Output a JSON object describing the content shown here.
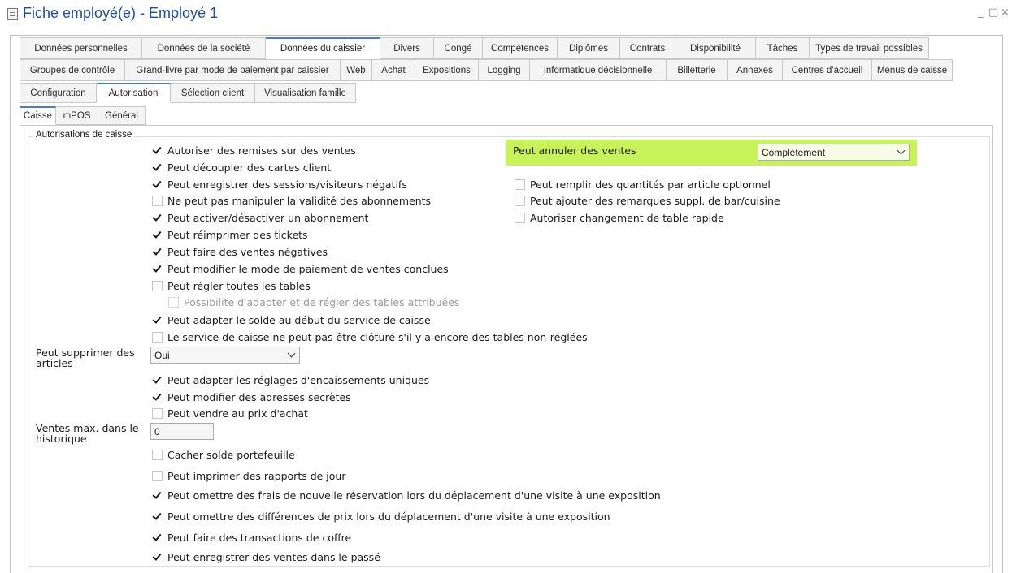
{
  "window": {
    "title": "Fiche employé(e) - Employé 1",
    "controls": [
      "_",
      "□",
      "×"
    ]
  },
  "tabs_row1": [
    {
      "label": "Données personnelles"
    },
    {
      "label": "Données de la société"
    },
    {
      "label": "Données du caissier",
      "active": true
    },
    {
      "label": "Divers"
    },
    {
      "label": "Congé"
    },
    {
      "label": "Compétences"
    },
    {
      "label": "Diplômes"
    },
    {
      "label": "Contrats"
    },
    {
      "label": "Disponibilité"
    },
    {
      "label": "Tâches"
    },
    {
      "label": "Types de travail possibles"
    }
  ],
  "tabs_row2": [
    {
      "label": "Groupes de contrôle"
    },
    {
      "label": "Grand-livre par mode de paiement par caissier"
    },
    {
      "label": "Web"
    },
    {
      "label": "Achat"
    },
    {
      "label": "Expositions"
    },
    {
      "label": "Logging"
    },
    {
      "label": "Informatique décisionnelle"
    },
    {
      "label": "Billetterie"
    },
    {
      "label": "Annexes"
    },
    {
      "label": "Centres d'accueil"
    },
    {
      "label": "Menus de caisse"
    }
  ],
  "subtabs": [
    {
      "label": "Configuration"
    },
    {
      "label": "Autorisation",
      "active": true
    },
    {
      "label": "Sélection client"
    },
    {
      "label": "Visualisation famille"
    }
  ],
  "subsubtabs": [
    {
      "label": "Caisse",
      "active": true
    },
    {
      "label": "mPOS"
    },
    {
      "label": "Général"
    }
  ],
  "group_title": "Autorisations de caisse",
  "checkboxes_left": [
    {
      "label": "Autoriser des remises sur des ventes",
      "checked": true
    },
    {
      "label": "Peut découpler des cartes client",
      "checked": true
    },
    {
      "label": "Peut enregistrer des sessions/visiteurs négatifs",
      "checked": true
    },
    {
      "label": "Ne peut pas manipuler la validité des abonnements",
      "checked": false
    },
    {
      "label": "Peut activer/désactiver un abonnement",
      "checked": true
    },
    {
      "label": "Peut réimprimer des tickets",
      "checked": true
    },
    {
      "label": "Peut faire des ventes négatives",
      "checked": true
    },
    {
      "label": "Peut modifier le mode de paiement de ventes conclues",
      "checked": true
    },
    {
      "label": "Peut régler toutes les tables",
      "checked": false
    },
    {
      "label": "Possibilité d'adapter et de régler des tables attribuées",
      "checked": false,
      "disabled": true
    },
    {
      "label": "Peut adapter le solde au début du service de caisse",
      "checked": true
    },
    {
      "label": "Le service de caisse ne peut pas être clôturé s'il y a encore des tables non-réglées",
      "checked": false
    }
  ],
  "delete_articles": {
    "label": "Peut supprimer des articles",
    "value": "Oui"
  },
  "checkboxes_mid": [
    {
      "label": "Peut adapter les réglages d'encaissements uniques",
      "checked": true
    },
    {
      "label": "Peut modifier des adresses secrètes",
      "checked": true
    },
    {
      "label": "Peut vendre au prix d'achat",
      "checked": false
    }
  ],
  "max_sales": {
    "label": "Ventes max. dans le historique",
    "value": "0"
  },
  "checkboxes_bottom": [
    {
      "label": "Cacher solde portefeuille",
      "checked": false
    },
    {
      "label": "Peut imprimer des rapports de jour",
      "checked": false
    },
    {
      "label": "Peut omettre des frais de nouvelle réservation lors du déplacement d'une visite à une exposition",
      "checked": true
    },
    {
      "label": "Peut omettre des différences de prix lors du déplacement d'une visite à une exposition",
      "checked": true
    },
    {
      "label": "Peut faire des transactions de coffre",
      "checked": true
    },
    {
      "label": "Peut enregistrer des ventes dans le passé",
      "checked": true
    }
  ],
  "cancel_sales": {
    "label": "Peut annuler des ventes",
    "value": "Complètement",
    "highlight_color": "#c8f25a"
  },
  "checkboxes_right": [
    {
      "label": "Peut remplir des quantités par article optionnel",
      "checked": false
    },
    {
      "label": "Peut ajouter des remarques suppl. de bar/cuisine",
      "checked": false
    },
    {
      "label": "Autoriser changement de table rapide",
      "checked": false
    }
  ],
  "colors": {
    "title": "#1f4e9c",
    "active_tab_accent": "#3d7fd8"
  }
}
